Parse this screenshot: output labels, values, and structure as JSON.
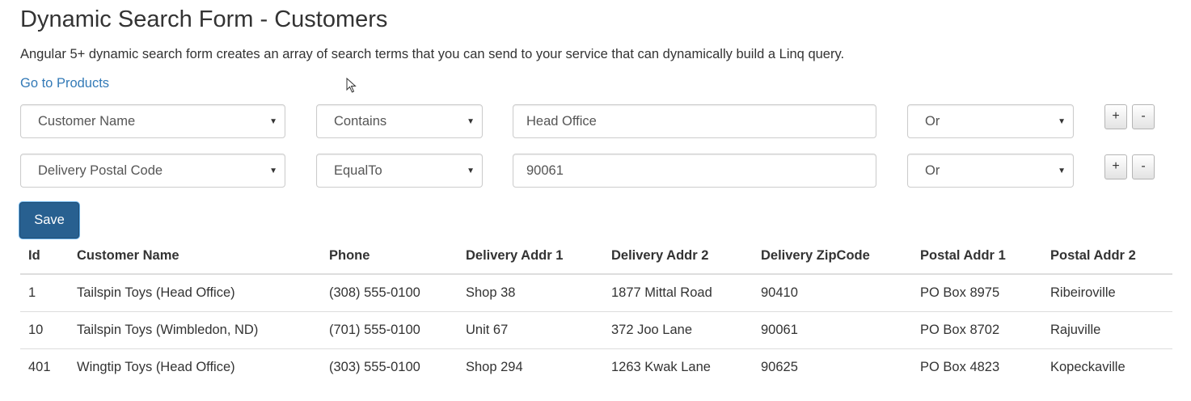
{
  "page": {
    "title": "Dynamic Search Form - Customers",
    "description": "Angular 5+ dynamic search form creates an array of search terms that you can send to your service that can dynamically build a Linq query.",
    "nav_link": "Go to Products"
  },
  "search_rows": [
    {
      "field": "Customer Name",
      "operator": "Contains",
      "value": "Head Office",
      "conjunction": "Or",
      "add_label": "+",
      "remove_label": "-"
    },
    {
      "field": "Delivery Postal Code",
      "operator": "EqualTo",
      "value": "90061",
      "conjunction": "Or",
      "add_label": "+",
      "remove_label": "-"
    }
  ],
  "save_label": "Save",
  "table": {
    "headers": [
      "Id",
      "Customer Name",
      "Phone",
      "Delivery Addr 1",
      "Delivery Addr 2",
      "Delivery ZipCode",
      "Postal Addr 1",
      "Postal Addr 2"
    ],
    "rows": [
      [
        "1",
        "Tailspin Toys (Head Office)",
        "(308) 555-0100",
        "Shop 38",
        "1877 Mittal Road",
        "90410",
        "PO Box 8975",
        "Ribeiroville"
      ],
      [
        "10",
        "Tailspin Toys (Wimbledon, ND)",
        "(701) 555-0100",
        "Unit 67",
        "372 Joo Lane",
        "90061",
        "PO Box 8702",
        "Rajuville"
      ],
      [
        "401",
        "Wingtip Toys (Head Office)",
        "(303) 555-0100",
        "Shop 294",
        "1263 Kwak Lane",
        "90625",
        "PO Box 4823",
        "Kopeckaville"
      ]
    ]
  },
  "icons": {
    "dropdown": "chevron-down-icon",
    "cursor": "mouse-pointer-icon"
  },
  "colors": {
    "link": "#337ab7",
    "primary_button": "#286090"
  }
}
